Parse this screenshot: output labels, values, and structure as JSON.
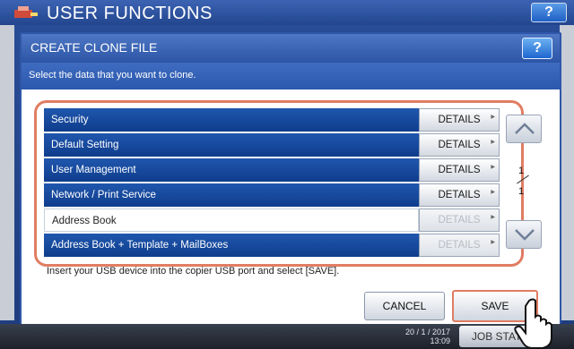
{
  "app": {
    "title": "USER FUNCTIONS",
    "help_label": "?"
  },
  "dialog": {
    "title": "CREATE CLONE FILE",
    "help_label": "?",
    "instruction": "Select the data that you want to clone.",
    "items": [
      {
        "label": "Security",
        "details": "DETAILS",
        "enabled": true,
        "selected": true
      },
      {
        "label": "Default Setting",
        "details": "DETAILS",
        "enabled": true,
        "selected": true
      },
      {
        "label": "User Management",
        "details": "DETAILS",
        "enabled": true,
        "selected": true
      },
      {
        "label": "Network / Print Service",
        "details": "DETAILS",
        "enabled": true,
        "selected": true
      },
      {
        "label": "Address Book",
        "details": "DETAILS",
        "enabled": false,
        "selected": false
      },
      {
        "label": "Address Book + Template + MailBoxes",
        "details": "DETAILS",
        "enabled": false,
        "selected": true
      }
    ],
    "page_current": "1",
    "page_total": "1",
    "usb_note": "Insert your USB device into the copier USB port and select [SAVE].",
    "cancel_label": "CANCEL",
    "save_label": "SAVE"
  },
  "footer": {
    "date": "20 / 1 / 2017",
    "time": "13:09",
    "job_status": "JOB STATUS"
  },
  "colors": {
    "accent": "#1f57ae",
    "highlight": "#e07d62"
  }
}
